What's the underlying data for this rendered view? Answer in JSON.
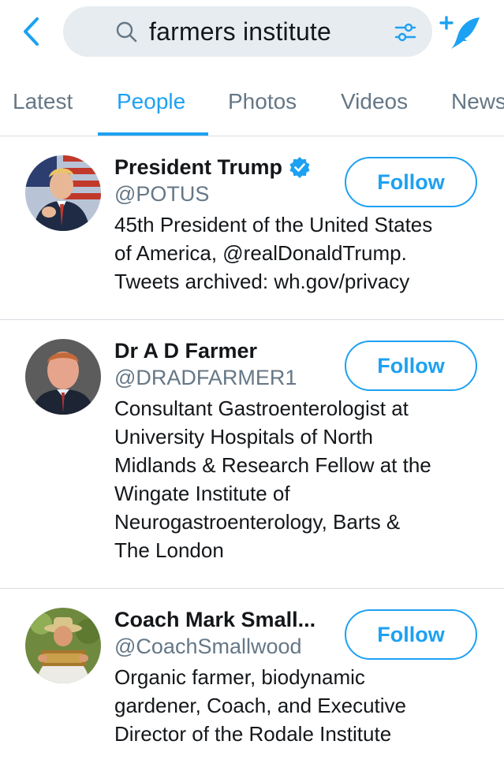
{
  "search": {
    "query": "farmers institute"
  },
  "tabs": [
    {
      "label": "Latest"
    },
    {
      "label": "People"
    },
    {
      "label": "Photos"
    },
    {
      "label": "Videos"
    },
    {
      "label": "News"
    }
  ],
  "active_tab": "People",
  "colors": {
    "accent": "#1da1f2",
    "secondary_text": "#657786",
    "search_bg": "#e6ecf0"
  },
  "users": [
    {
      "name": "President Trump",
      "handle": "@POTUS",
      "verified": true,
      "follow_label": "Follow",
      "bio": [
        "45th President of the United States",
        "of America, @realDonaldTrump.",
        "Tweets archived: wh.gov/privacy"
      ]
    },
    {
      "name": "Dr A D Farmer",
      "handle": "@DRADFARMER1",
      "verified": false,
      "follow_label": "Follow",
      "bio": [
        "Consultant Gastroenterologist at",
        "University Hospitals of North",
        "Midlands & Research Fellow at the",
        "Wingate Institute of",
        "Neurogastroenterology, Barts &",
        "The London"
      ]
    },
    {
      "name": "Coach Mark Small...",
      "handle": "@CoachSmallwood",
      "verified": false,
      "follow_label": "Follow",
      "bio": [
        "Organic farmer, biodynamic",
        "gardener, Coach, and Executive",
        "Director of the Rodale Institute"
      ]
    }
  ]
}
